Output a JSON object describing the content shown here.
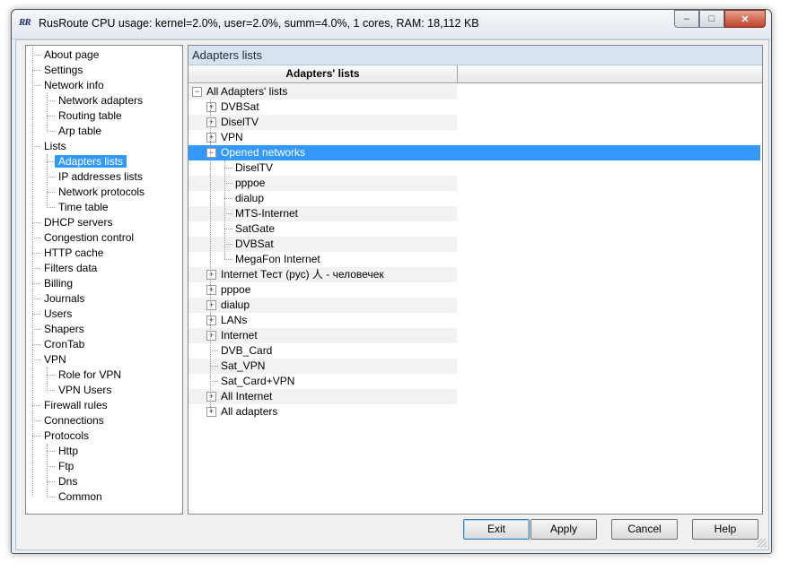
{
  "window": {
    "logo": "RR",
    "title": "RusRoute   CPU usage: kernel=2.0%, user=2.0%, summ=4.0%, 1 cores,   RAM: 18,112 KB",
    "minimize_icon": "minimize-icon",
    "maximize_icon": "maximize-icon",
    "close_icon": "close-icon"
  },
  "nav": {
    "items": [
      {
        "label": "About page",
        "level": 0
      },
      {
        "label": "Settings",
        "level": 0
      },
      {
        "label": "Network info",
        "level": 0,
        "expanded": true
      },
      {
        "label": "Network adapters",
        "level": 1
      },
      {
        "label": "Routing table",
        "level": 1
      },
      {
        "label": "Arp table",
        "level": 1
      },
      {
        "label": "Lists",
        "level": 0,
        "expanded": true
      },
      {
        "label": "Adapters lists",
        "level": 1,
        "selected": true
      },
      {
        "label": "IP addresses lists",
        "level": 1
      },
      {
        "label": "Network protocols",
        "level": 1
      },
      {
        "label": "Time table",
        "level": 1
      },
      {
        "label": "DHCP servers",
        "level": 0
      },
      {
        "label": "Congestion control",
        "level": 0
      },
      {
        "label": "HTTP cache",
        "level": 0
      },
      {
        "label": "Filters data",
        "level": 0
      },
      {
        "label": "Billing",
        "level": 0
      },
      {
        "label": "Journals",
        "level": 0
      },
      {
        "label": "Users",
        "level": 0
      },
      {
        "label": "Shapers",
        "level": 0
      },
      {
        "label": "CronTab",
        "level": 0
      },
      {
        "label": "VPN",
        "level": 0,
        "expanded": true
      },
      {
        "label": "Role for VPN",
        "level": 1
      },
      {
        "label": "VPN Users",
        "level": 1
      },
      {
        "label": "Firewall rules",
        "level": 0
      },
      {
        "label": "Connections",
        "level": 0
      },
      {
        "label": "Protocols",
        "level": 0,
        "expanded": true
      },
      {
        "label": "Http",
        "level": 1
      },
      {
        "label": "Ftp",
        "level": 1
      },
      {
        "label": "Dns",
        "level": 1
      },
      {
        "label": "Common",
        "level": 1
      }
    ]
  },
  "main": {
    "section_title": "Adapters lists",
    "column_header": "Adapters' lists",
    "tree": [
      {
        "label": "All Adapters' lists",
        "level": 0,
        "expander": "-"
      },
      {
        "label": "DVBSat",
        "level": 1,
        "expander": "+"
      },
      {
        "label": "DiselTV",
        "level": 1,
        "expander": "+"
      },
      {
        "label": "VPN",
        "level": 1,
        "expander": "+"
      },
      {
        "label": "Opened networks",
        "level": 1,
        "expander": "-",
        "selected": true
      },
      {
        "label": "DiselTV",
        "level": 2
      },
      {
        "label": "pppoe",
        "level": 2
      },
      {
        "label": "dialup",
        "level": 2
      },
      {
        "label": "MTS-Internet",
        "level": 2
      },
      {
        "label": "SatGate",
        "level": 2
      },
      {
        "label": "DVBSat",
        "level": 2
      },
      {
        "label": "MegaFon Internet",
        "level": 2
      },
      {
        "label": "Internet Тест (рус) 人 - человечек",
        "level": 1,
        "expander": "+"
      },
      {
        "label": "pppoe",
        "level": 1,
        "expander": "+"
      },
      {
        "label": "dialup",
        "level": 1,
        "expander": "+"
      },
      {
        "label": "LANs",
        "level": 1,
        "expander": "+"
      },
      {
        "label": "Internet",
        "level": 1,
        "expander": "+"
      },
      {
        "label": "DVB_Card",
        "level": 1
      },
      {
        "label": "Sat_VPN",
        "level": 1
      },
      {
        "label": "Sat_Card+VPN",
        "level": 1
      },
      {
        "label": "All Internet",
        "level": 1,
        "expander": "+"
      },
      {
        "label": "All adapters",
        "level": 1,
        "expander": "+"
      }
    ]
  },
  "buttons": {
    "exit": "Exit",
    "apply": "Apply",
    "cancel": "Cancel",
    "help": "Help"
  },
  "colors": {
    "selection": "#3399ff",
    "header_bg": "#d7e3ef"
  }
}
